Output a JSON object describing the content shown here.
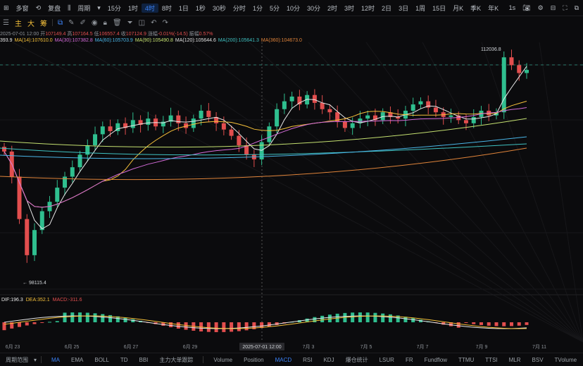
{
  "topbar": {
    "left_items": [
      {
        "name": "multi-window-button",
        "label": "多窗"
      },
      {
        "name": "replay-button",
        "label": "复盘"
      },
      {
        "name": "period-button",
        "label": "周期"
      }
    ],
    "intervals": [
      "15分",
      "1时",
      "4时",
      "8时",
      "1日",
      "1秒",
      "30秒",
      "分时",
      "1分",
      "5分",
      "10分",
      "30分",
      "2时",
      "3时",
      "12时",
      "2日",
      "3日",
      "1周",
      "15日",
      "月K",
      "季K",
      "年K"
    ],
    "active_interval": "4时",
    "right_label": "1s"
  },
  "toolbar2": {
    "tags": [
      "主",
      "大",
      "筹"
    ]
  },
  "ohlc": {
    "date": "2025-07-01 12:00",
    "open_label": "开",
    "open": "107149.4",
    "high_label": "高",
    "high": "107164.5",
    "low_label": "低",
    "low": "106557.4",
    "close_label": "收",
    "close": "107124.9",
    "change_label": "涨幅",
    "change": "-0.01%(-14.5)",
    "amp_label": "振幅",
    "amp": "0.57%"
  },
  "ma_legend": [
    {
      "text": "393.9",
      "color": "#e8e8e8"
    },
    {
      "text": "MA(14):107610.0",
      "color": "#f5c03a"
    },
    {
      "text": "MA(30):107382.8",
      "color": "#d36bd8"
    },
    {
      "text": "MA(60):105703.9",
      "color": "#4ab6e8"
    },
    {
      "text": "MA(90):105490.8",
      "color": "#c4e070"
    },
    {
      "text": "MA(120):105644.6",
      "color": "#e0e0e0"
    },
    {
      "text": "MA(200):105641.3",
      "color": "#3fc2c2"
    },
    {
      "text": "MA(360):104673.0",
      "color": "#e0843a"
    }
  ],
  "annotations": {
    "high_label": "112036.8",
    "low_label": "98115.4"
  },
  "macd_legend": [
    {
      "text": "DIF:196.3",
      "color": "#e8e8e8"
    },
    {
      "text": "DEA:352.1",
      "color": "#f5c03a"
    },
    {
      "text": "MACD:-311.6",
      "color": "#e24e4e"
    }
  ],
  "xaxis": {
    "labels": [
      "6月 23",
      "6月 25",
      "6月 27",
      "6月 29",
      "7月 3",
      "7月 5",
      "7月 7",
      "7月 9",
      "7月 11"
    ],
    "crosshair_label": "2025-07-01 12:00"
  },
  "bottombar": {
    "left_label": "周期范围",
    "indicators_main": [
      "MA",
      "EMA",
      "BOLL",
      "TD",
      "BBI",
      "主力大单跟踪"
    ],
    "indicators_sub": [
      "Volume",
      "Position",
      "MACD",
      "RSI",
      "KDJ",
      "爆仓统计",
      "LSUR",
      "FR",
      "Fundflow",
      "TTMU",
      "TTSI",
      "MLR",
      "BSV",
      "TVolume"
    ],
    "active_main": "MA",
    "active_sub": "MACD"
  },
  "colors": {
    "up": "#2fbf8f",
    "down": "#e24e4e",
    "accent": "#3b82f6"
  }
}
